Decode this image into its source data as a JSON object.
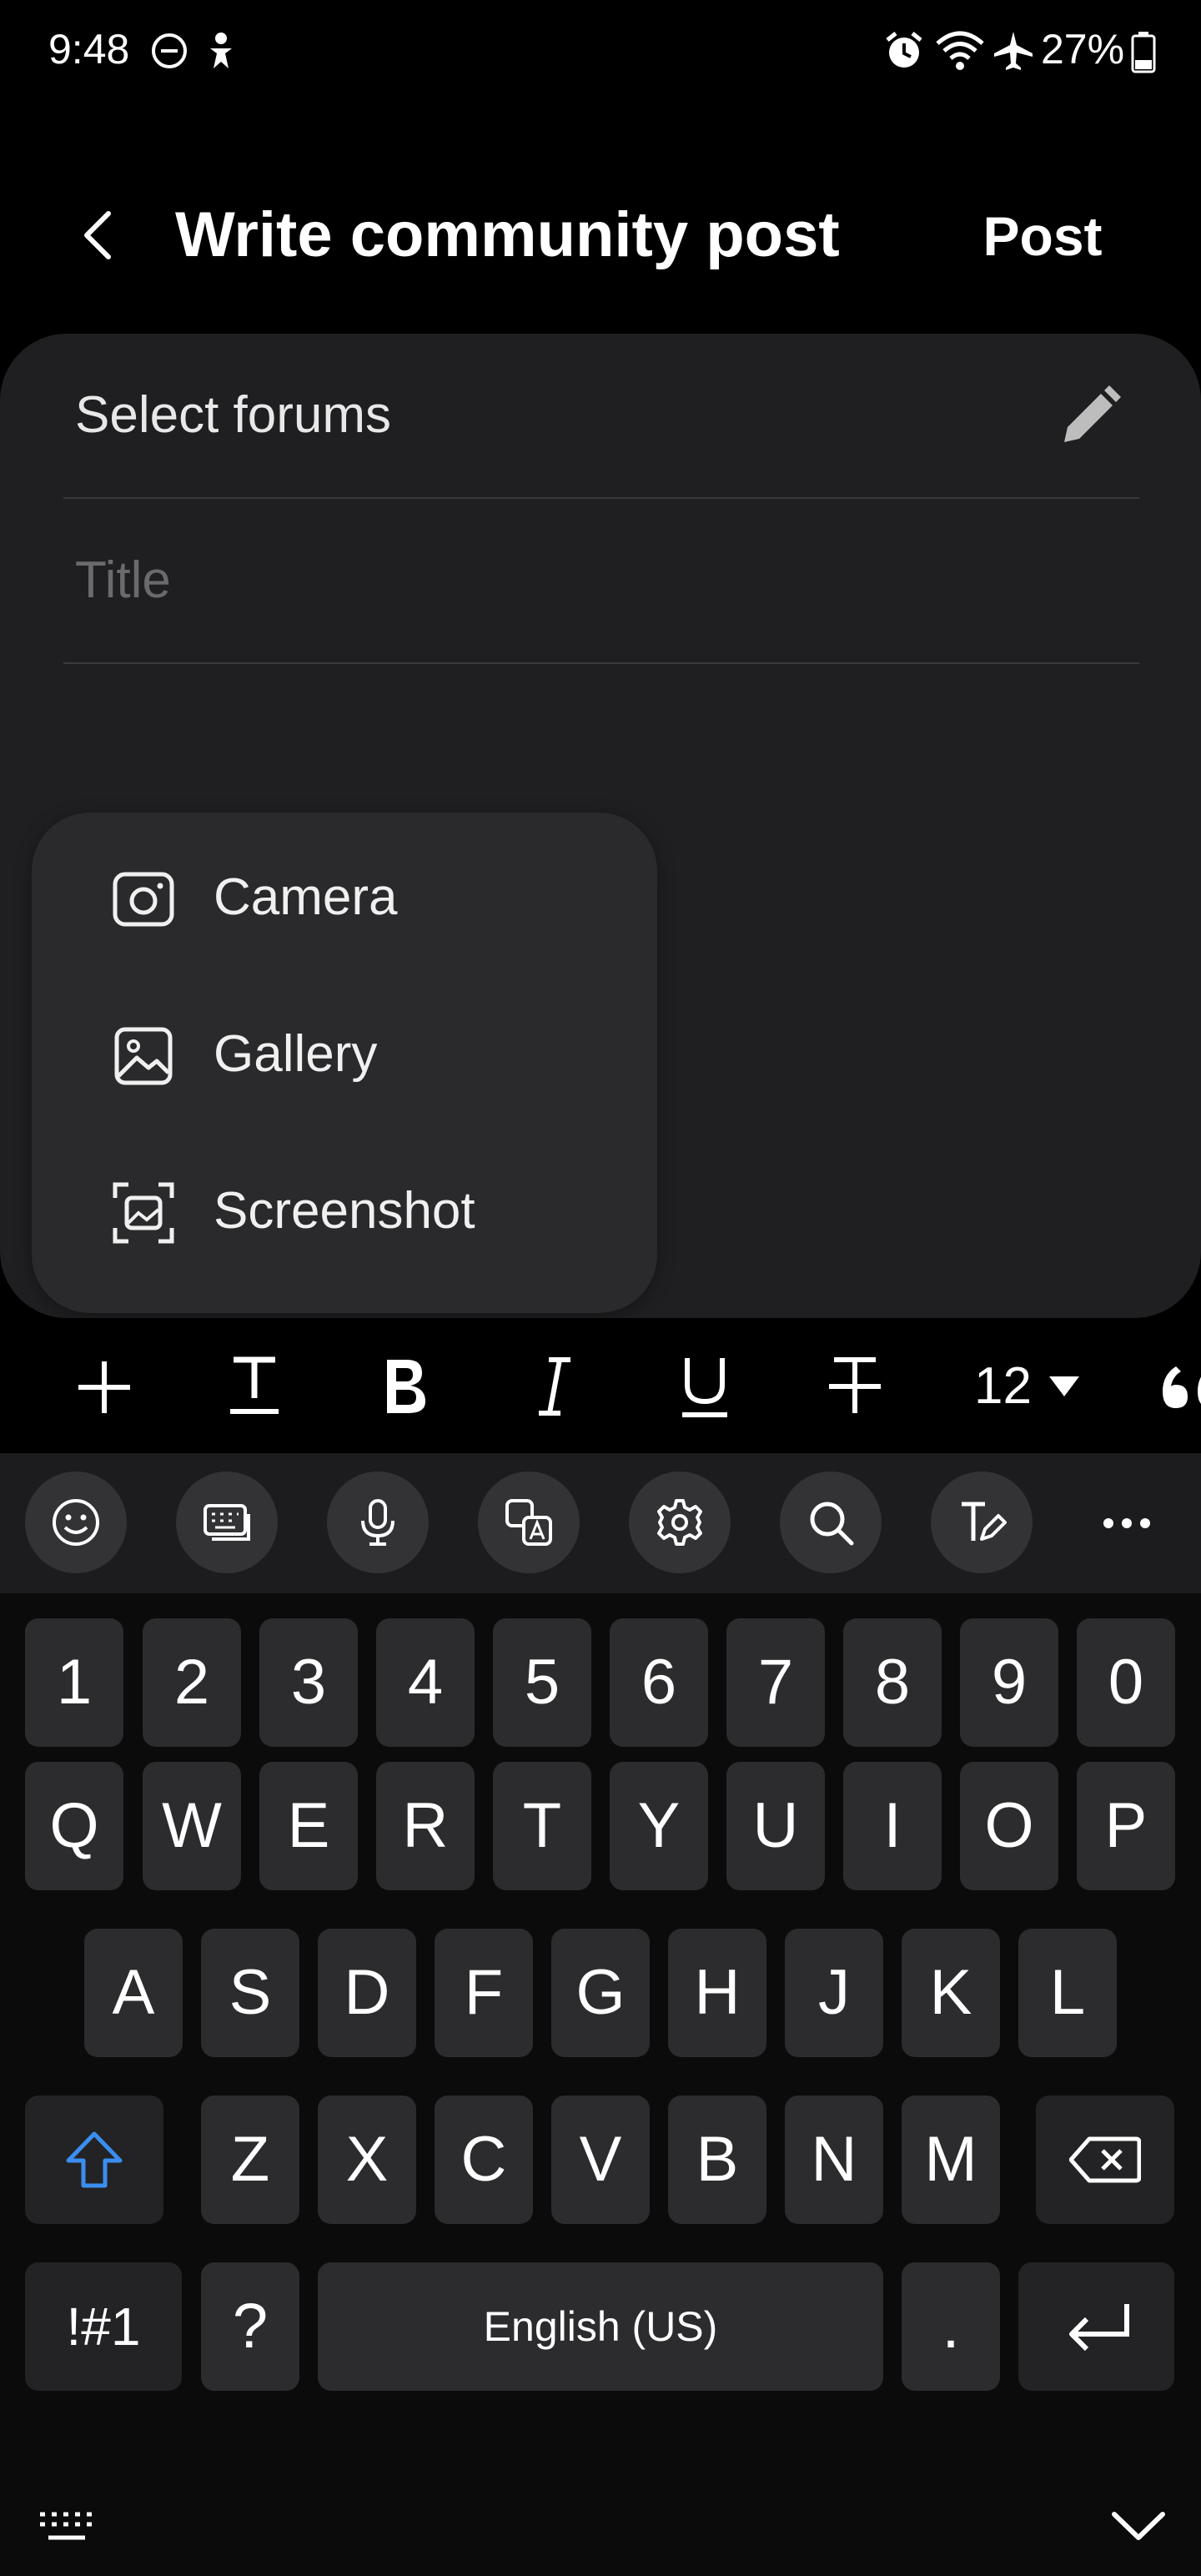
{
  "status_bar": {
    "time": "9:48",
    "battery": "27%",
    "icons": [
      "dnd-icon",
      "accessibility-icon",
      "alarm-icon",
      "wifi-icon",
      "airplane-icon",
      "battery-icon"
    ]
  },
  "header": {
    "title": "Write community post",
    "post_label": "Post"
  },
  "form": {
    "forums_label": "Select forums",
    "title_placeholder": "Title"
  },
  "attach_menu": {
    "items": [
      {
        "label": "Camera",
        "icon": "camera-icon"
      },
      {
        "label": "Gallery",
        "icon": "gallery-icon"
      },
      {
        "label": "Screenshot",
        "icon": "screenshot-icon"
      }
    ]
  },
  "format_toolbar": {
    "font_size": "12",
    "tools": [
      "add",
      "text-style",
      "bold",
      "italic",
      "underline",
      "strikethrough",
      "font-size",
      "quote"
    ]
  },
  "keyboard": {
    "toolbar_icons": [
      "emoji-icon",
      "keyboard-mode-icon",
      "microphone-icon",
      "translate-icon",
      "settings-icon",
      "search-icon",
      "handwriting-icon",
      "more-icon"
    ],
    "number_row": [
      "1",
      "2",
      "3",
      "4",
      "5",
      "6",
      "7",
      "8",
      "9",
      "0"
    ],
    "row1": [
      "Q",
      "W",
      "E",
      "R",
      "T",
      "Y",
      "U",
      "I",
      "O",
      "P"
    ],
    "row2": [
      "A",
      "S",
      "D",
      "F",
      "G",
      "H",
      "J",
      "K",
      "L"
    ],
    "row3": [
      "Z",
      "X",
      "C",
      "V",
      "B",
      "N",
      "M"
    ],
    "symbols_label": "!#1",
    "question_label": "?",
    "space_label": "English (US)",
    "period_label": ".",
    "accent_color": "#3b8ef0"
  }
}
